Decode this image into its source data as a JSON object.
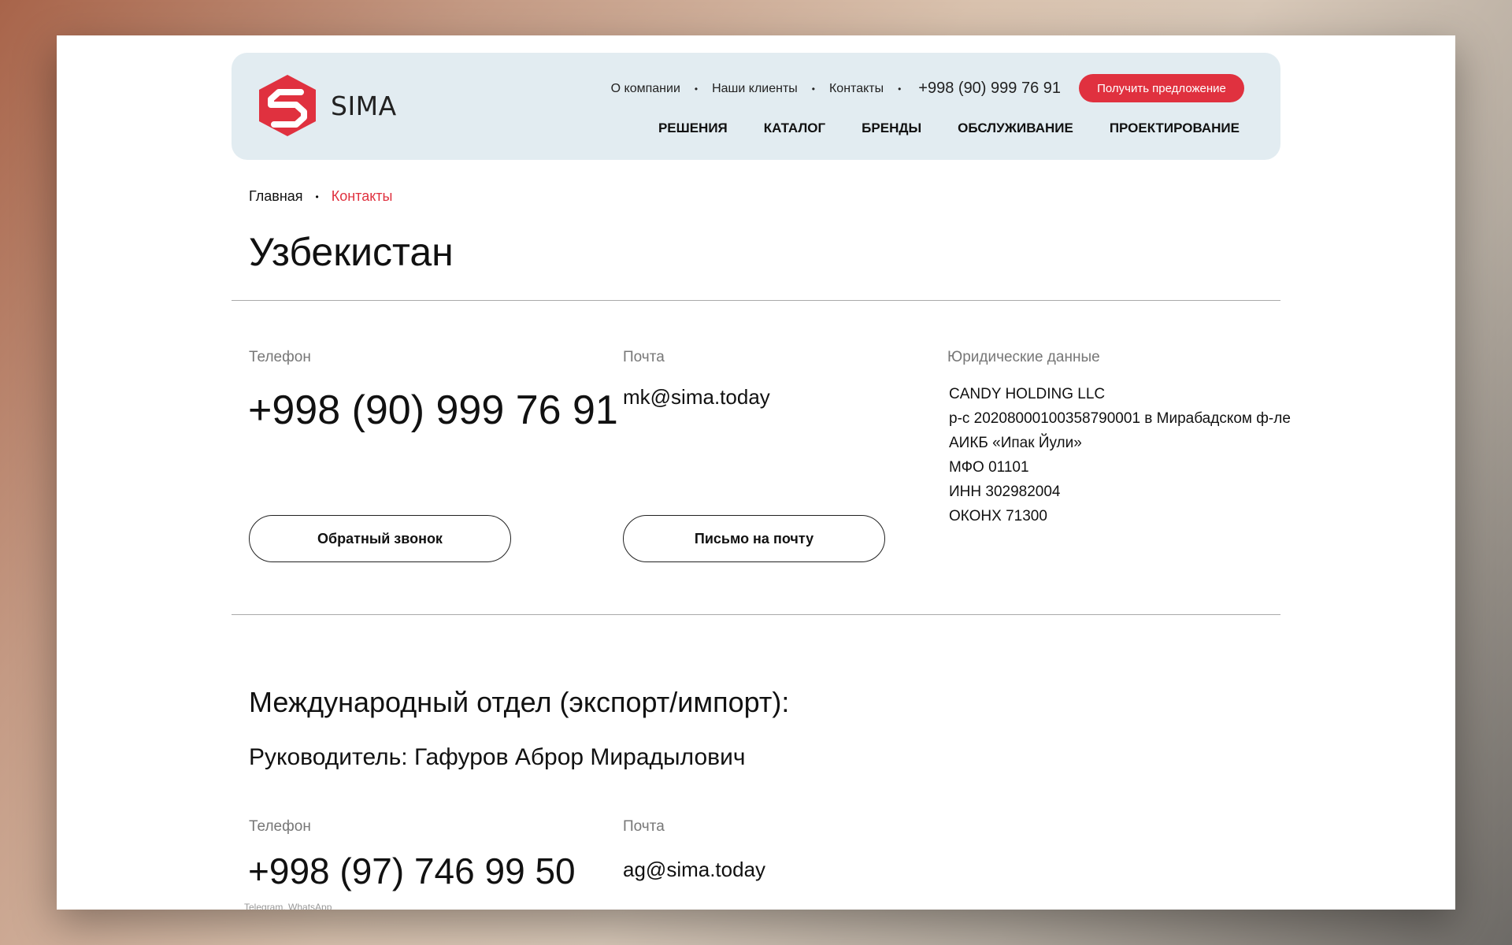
{
  "brand": {
    "name": "SIMA",
    "accent_color": "#e0313f"
  },
  "topnav": {
    "items": [
      "О компании",
      "Наши клиенты",
      "Контакты"
    ],
    "phone": "+998 (90) 999 76 91",
    "cta_label": "Получить предложение"
  },
  "mainnav": {
    "items": [
      "РЕШЕНИЯ",
      "КАТАЛОГ",
      "БРЕНДЫ",
      "ОБСЛУЖИВАНИЕ",
      "ПРОЕКТИРОВАНИЕ"
    ]
  },
  "breadcrumb": {
    "home": "Главная",
    "current": "Контакты"
  },
  "page_title": "Узбекистан",
  "contacts": {
    "phone_label": "Телефон",
    "phone": "+998 (90) 999 76 91",
    "email_label": "Почта",
    "email": "mk@sima.today",
    "legal_label": "Юридические данные",
    "legal_lines": [
      "CANDY HOLDING LLC",
      "р-с 20208000100358790001 в Мирабадском ф-ле",
      "АИКБ «Ипак Йули»",
      "МФО 01101",
      "ИНН 302982004",
      "ОКОНХ 71300"
    ],
    "callback_button": "Обратный звонок",
    "mail_button": "Письмо на почту"
  },
  "international": {
    "title": "Международный отдел (экспорт/импорт):",
    "manager": "Руководитель: Гафуров Аброр Мирадылович",
    "phone_label": "Телефон",
    "phone": "+998 (97) 746 99 50",
    "email_label": "Почта",
    "email": "ag@sima.today",
    "messengers": "Telegram, WhatsApp"
  }
}
